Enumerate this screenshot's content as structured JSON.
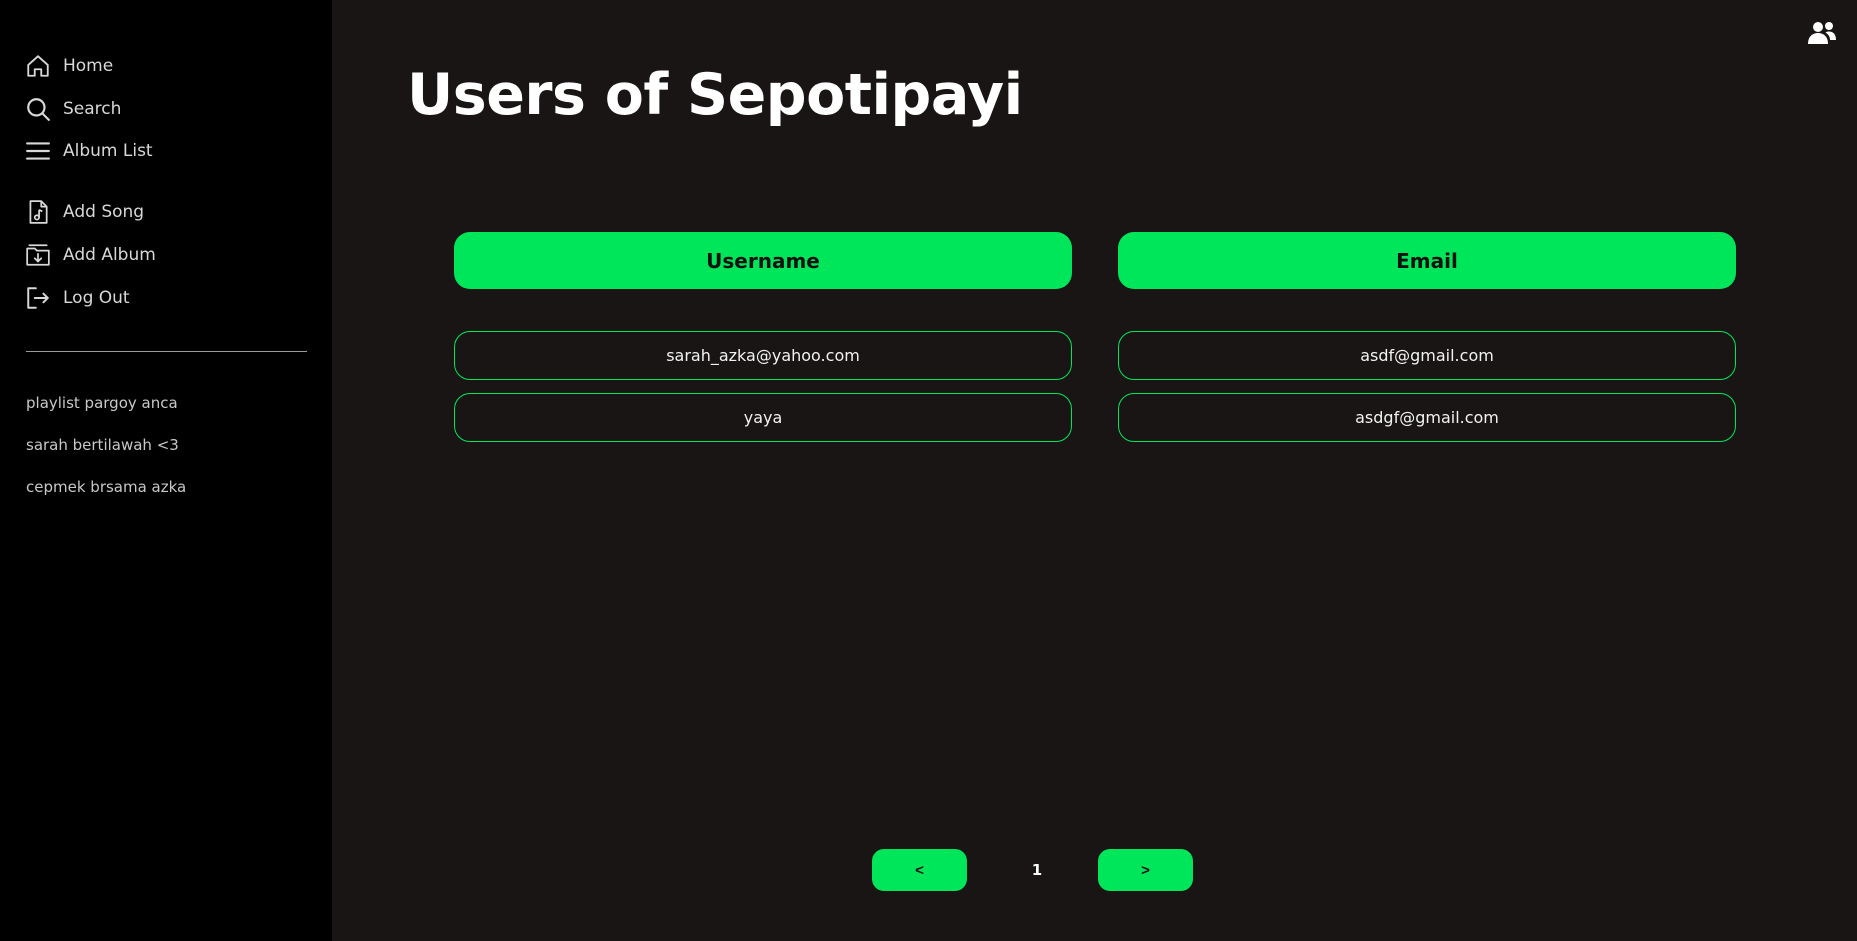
{
  "sidebar": {
    "nav": [
      {
        "label": "Home",
        "icon": "home-icon"
      },
      {
        "label": "Search",
        "icon": "search-icon"
      },
      {
        "label": "Album List",
        "icon": "menu-icon"
      }
    ],
    "actions": [
      {
        "label": "Add Song",
        "icon": "music-file-icon"
      },
      {
        "label": "Add Album",
        "icon": "folder-download-icon"
      },
      {
        "label": "Log Out",
        "icon": "logout-icon"
      }
    ],
    "playlists": [
      "playlist pargoy anca",
      "sarah bertilawah <3",
      "cepmek brsama azka"
    ]
  },
  "main": {
    "title": "Users of Sepotipayi",
    "top_icon": "users-icon",
    "table": {
      "headers": [
        "Username",
        "Email"
      ],
      "rows": [
        [
          "sarah_azka@yahoo.com",
          "asdf@gmail.com"
        ],
        [
          "yaya",
          "asdgf@gmail.com"
        ]
      ]
    },
    "pagination": {
      "prev_label": "<",
      "current_page": "1",
      "next_label": ">"
    }
  },
  "colors": {
    "accent": "#00e65a",
    "sidebar_bg": "#000000",
    "main_bg": "#1a1515"
  }
}
